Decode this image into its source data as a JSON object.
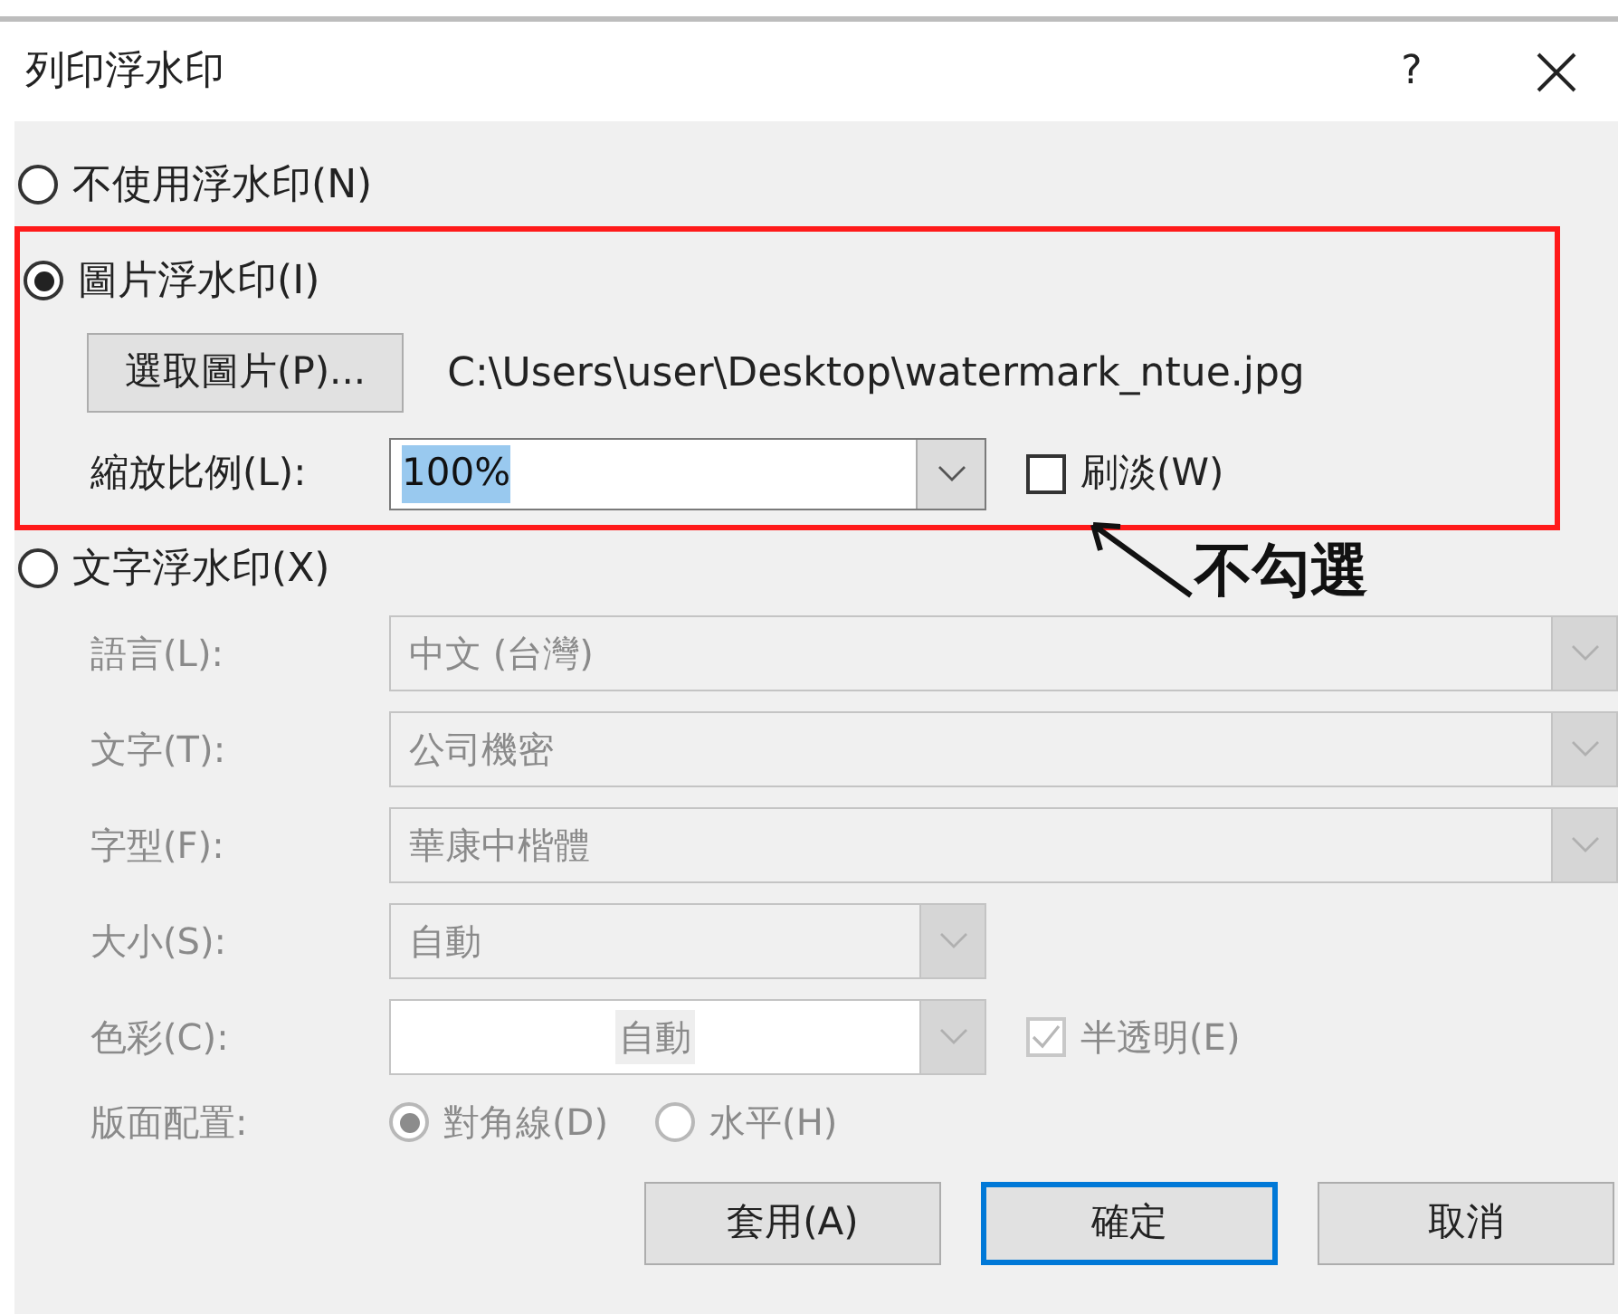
{
  "window": {
    "title": "列印浮水印",
    "help": "?"
  },
  "options": [
    {
      "kind": "none",
      "label": "不使用浮水印(N)",
      "selected": false
    },
    {
      "kind": "picture",
      "label": "圖片浮水印(I)",
      "selected": true
    },
    {
      "kind": "text",
      "label": "文字浮水印(X)",
      "selected": false
    }
  ],
  "picture_settings": {
    "select_button": "選取圖片(P)...",
    "path": "C:\\Users\\user\\Desktop\\watermark_ntue.jpg",
    "scale_label": "縮放比例(L):",
    "scale_value": "100%",
    "scale_value_selected": true,
    "washout": {
      "label": "刷淡(W)",
      "checked": false
    }
  },
  "text_settings": {
    "disabled": true,
    "fields": [
      {
        "kind": "wide",
        "label": "語言(L):",
        "value": "中文 (台灣)"
      },
      {
        "kind": "wide",
        "label": "文字(T):",
        "value": "公司機密"
      },
      {
        "kind": "wide",
        "label": "字型(F):",
        "value": "華康中楷體"
      },
      {
        "kind": "narrow",
        "label": "大小(S):",
        "value": "自動"
      },
      {
        "kind": "color",
        "label": "色彩(C):",
        "value": "自動"
      }
    ],
    "semitransparent": {
      "label": "半透明(E)",
      "checked": true
    },
    "layout_label": "版面配置:",
    "layout_options": [
      {
        "label": "對角線(D)",
        "selected": true
      },
      {
        "label": "水平(H)",
        "selected": false
      }
    ]
  },
  "buttons": [
    {
      "label": "套用(A)",
      "default": false
    },
    {
      "label": "確定",
      "default": true
    },
    {
      "label": "取消",
      "default": false
    }
  ],
  "annotation": {
    "text": "不勾選"
  }
}
